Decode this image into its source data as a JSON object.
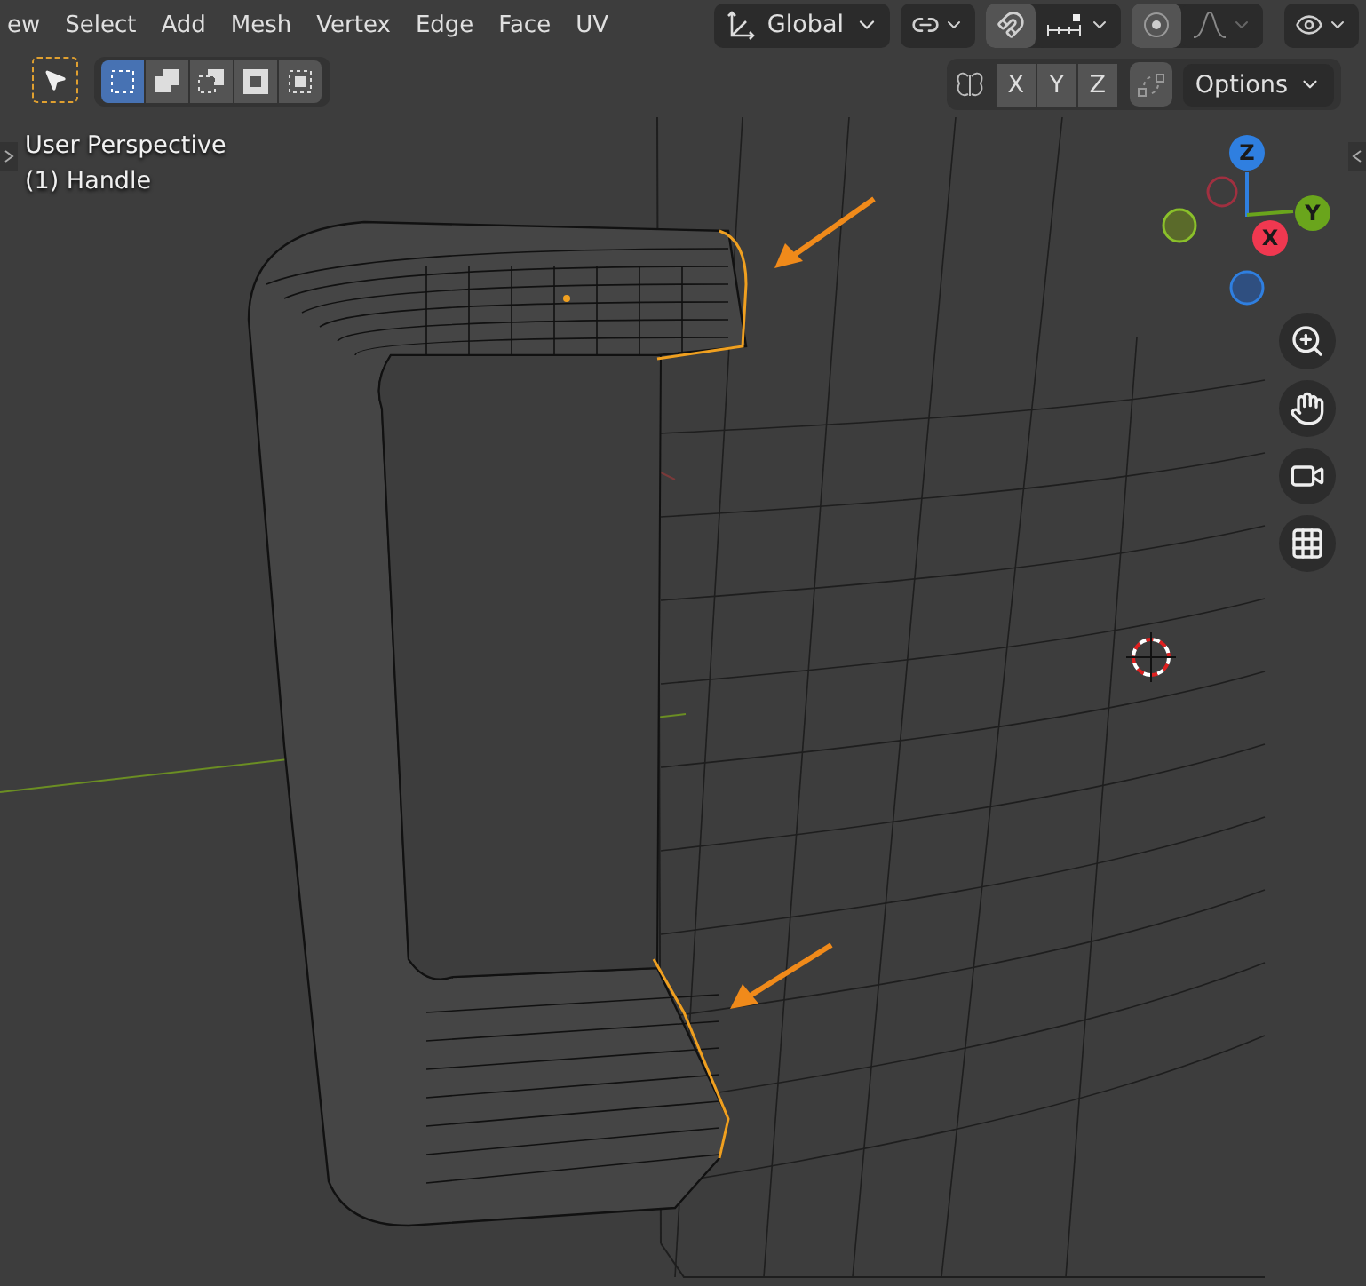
{
  "menu": [
    {
      "label": "ew"
    },
    {
      "label": "Select"
    },
    {
      "label": "Add"
    },
    {
      "label": "Mesh"
    },
    {
      "label": "Vertex"
    },
    {
      "label": "Edge"
    },
    {
      "label": "Face"
    },
    {
      "label": "UV"
    }
  ],
  "transform_orientation": {
    "label": "Global"
  },
  "select_modes": [
    {
      "selected": true
    },
    {
      "selected": false
    },
    {
      "selected": false
    },
    {
      "selected": false
    },
    {
      "selected": false
    }
  ],
  "mirror_axes": [
    {
      "label": "X"
    },
    {
      "label": "Y"
    },
    {
      "label": "Z"
    }
  ],
  "options": {
    "label": "Options"
  },
  "viewport": {
    "view_name": "User Perspective",
    "object_name": "(1) Handle"
  },
  "gizmo": [
    {
      "label": "Z",
      "color": "#2f7fe0"
    },
    {
      "label": "Y",
      "color": "#6aa51c"
    },
    {
      "label": "X",
      "color": "#f03850"
    }
  ]
}
